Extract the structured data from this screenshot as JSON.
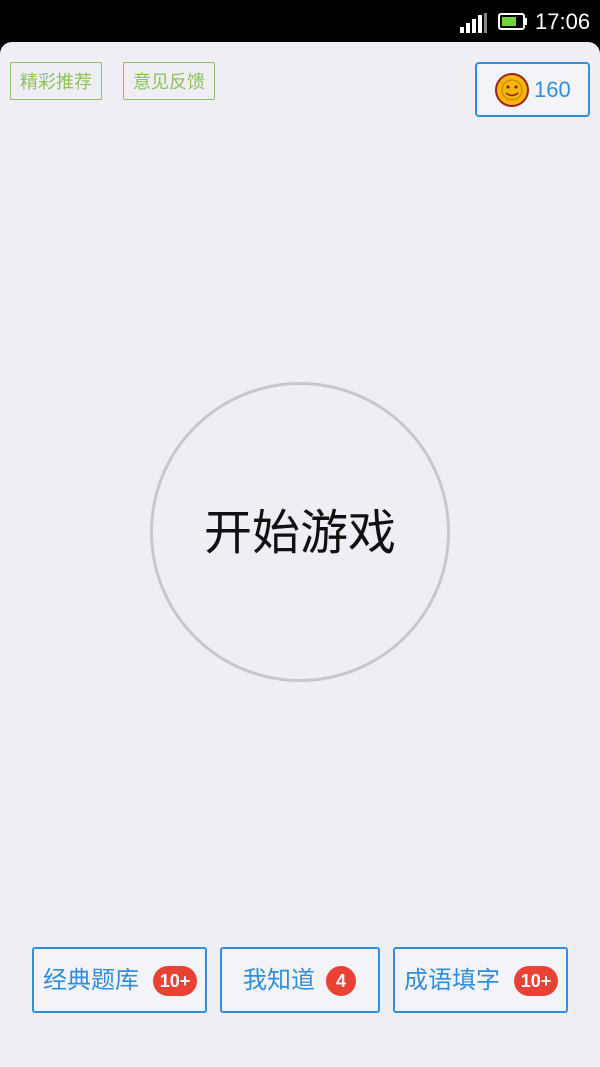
{
  "status_bar": {
    "time": "17:06",
    "icons": [
      "signal-icon",
      "battery-icon"
    ]
  },
  "top_bar": {
    "recommend_label": "精彩推荐",
    "feedback_label": "意见反馈",
    "coin_count": "160",
    "coin_icon": "coin-icon"
  },
  "main": {
    "start_label": "开始游戏"
  },
  "bottom_bar": {
    "buttons": [
      {
        "label": "经典题库",
        "badge": "10+"
      },
      {
        "label": "我知道",
        "badge": "4"
      },
      {
        "label": "成语填字",
        "badge": "10+"
      }
    ]
  },
  "colors": {
    "accent_blue": "#2f8ee0",
    "accent_green": "#8dc35a",
    "badge_red": "#e94235",
    "background": "#eeeef4"
  }
}
